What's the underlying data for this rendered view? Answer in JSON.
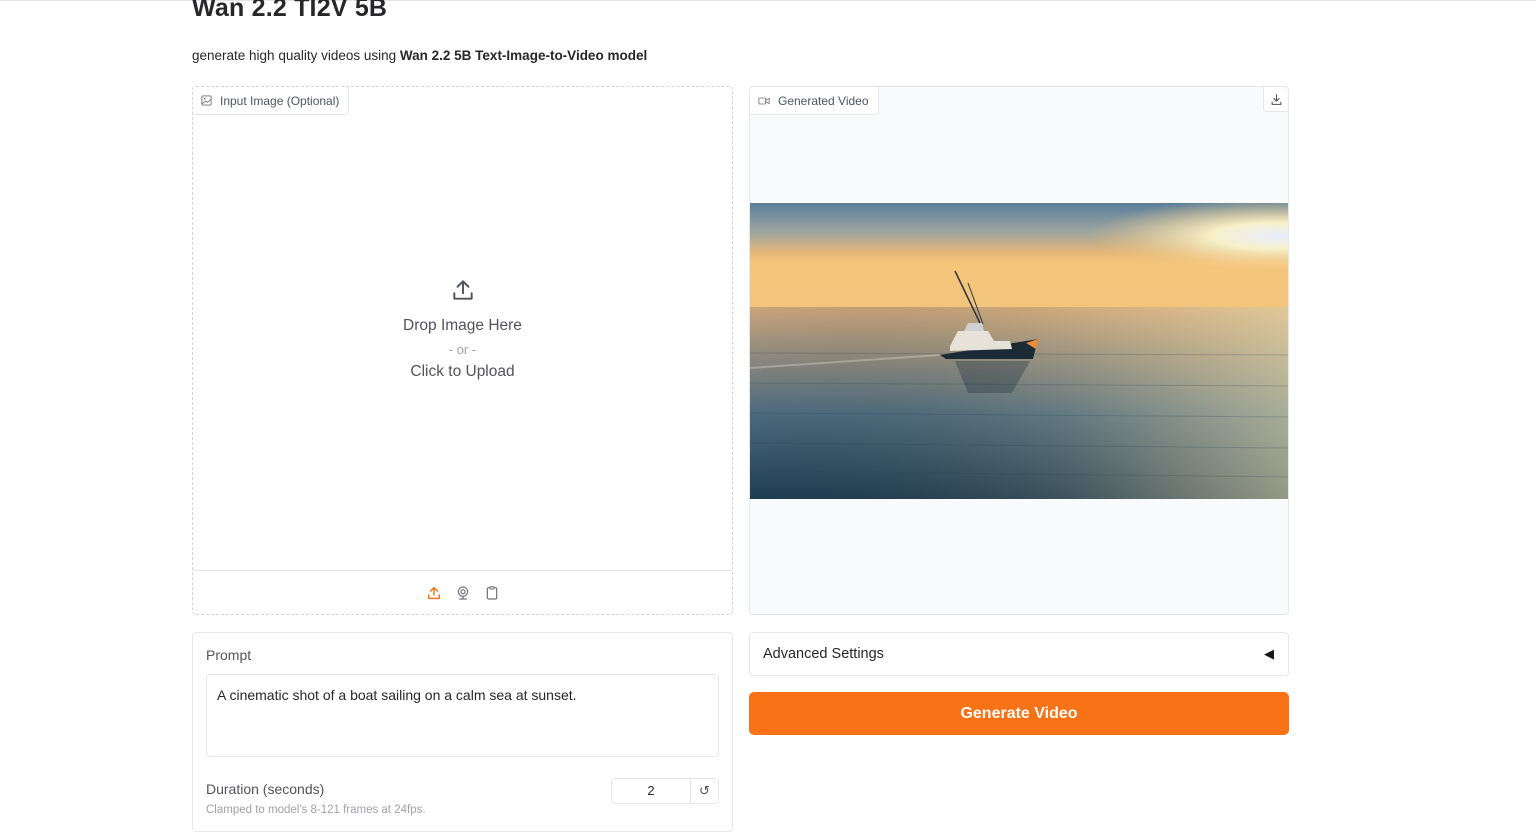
{
  "app": {
    "title": "Wan 2.2 TI2V 5B",
    "subtitle_prefix": "generate high quality videos using ",
    "subtitle_model": "Wan 2.2 5B Text-Image-to-Video model"
  },
  "input_image": {
    "label": "Input Image (Optional)",
    "drop_text": "Drop Image Here",
    "or_text": "- or -",
    "click_text": "Click to Upload",
    "sources": [
      "upload-icon",
      "webcam-icon",
      "clipboard-icon"
    ]
  },
  "output_video": {
    "label": "Generated Video"
  },
  "prompt": {
    "label": "Prompt",
    "value": "A cinematic shot of a boat sailing on a calm sea at sunset."
  },
  "duration": {
    "label": "Duration (seconds)",
    "info": "Clamped to model's 8-121 frames at 24fps.",
    "value": "2"
  },
  "advanced": {
    "label": "Advanced Settings",
    "caret": "◀"
  },
  "generate": {
    "label": "Generate Video"
  },
  "colors": {
    "accent": "#f97316",
    "text": "#27272a",
    "muted": "#a1a1aa"
  }
}
